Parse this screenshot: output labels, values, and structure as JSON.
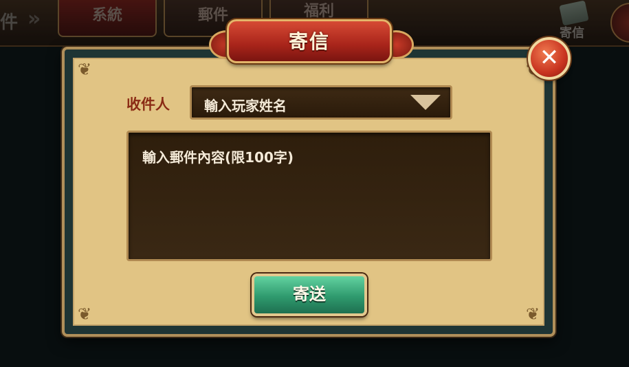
{
  "background": {
    "title_fragment": "件",
    "tabs": [
      {
        "label": "系統"
      },
      {
        "label": "郵件"
      },
      {
        "label": "福利"
      }
    ],
    "send_label": "寄信"
  },
  "dialog": {
    "title": "寄信",
    "close_symbol": "✕",
    "recipient_label": "收件人",
    "recipient_placeholder": "輸入玩家姓名",
    "message_placeholder": "輸入郵件內容(限100字)",
    "send_button": "寄送"
  },
  "colors": {
    "panel": "#e1c484",
    "frame": "#1e3434",
    "banner": "#a8241a",
    "send_button": "#2f9a6e",
    "close_button": "#c83420",
    "field": "#2a1a0a"
  }
}
